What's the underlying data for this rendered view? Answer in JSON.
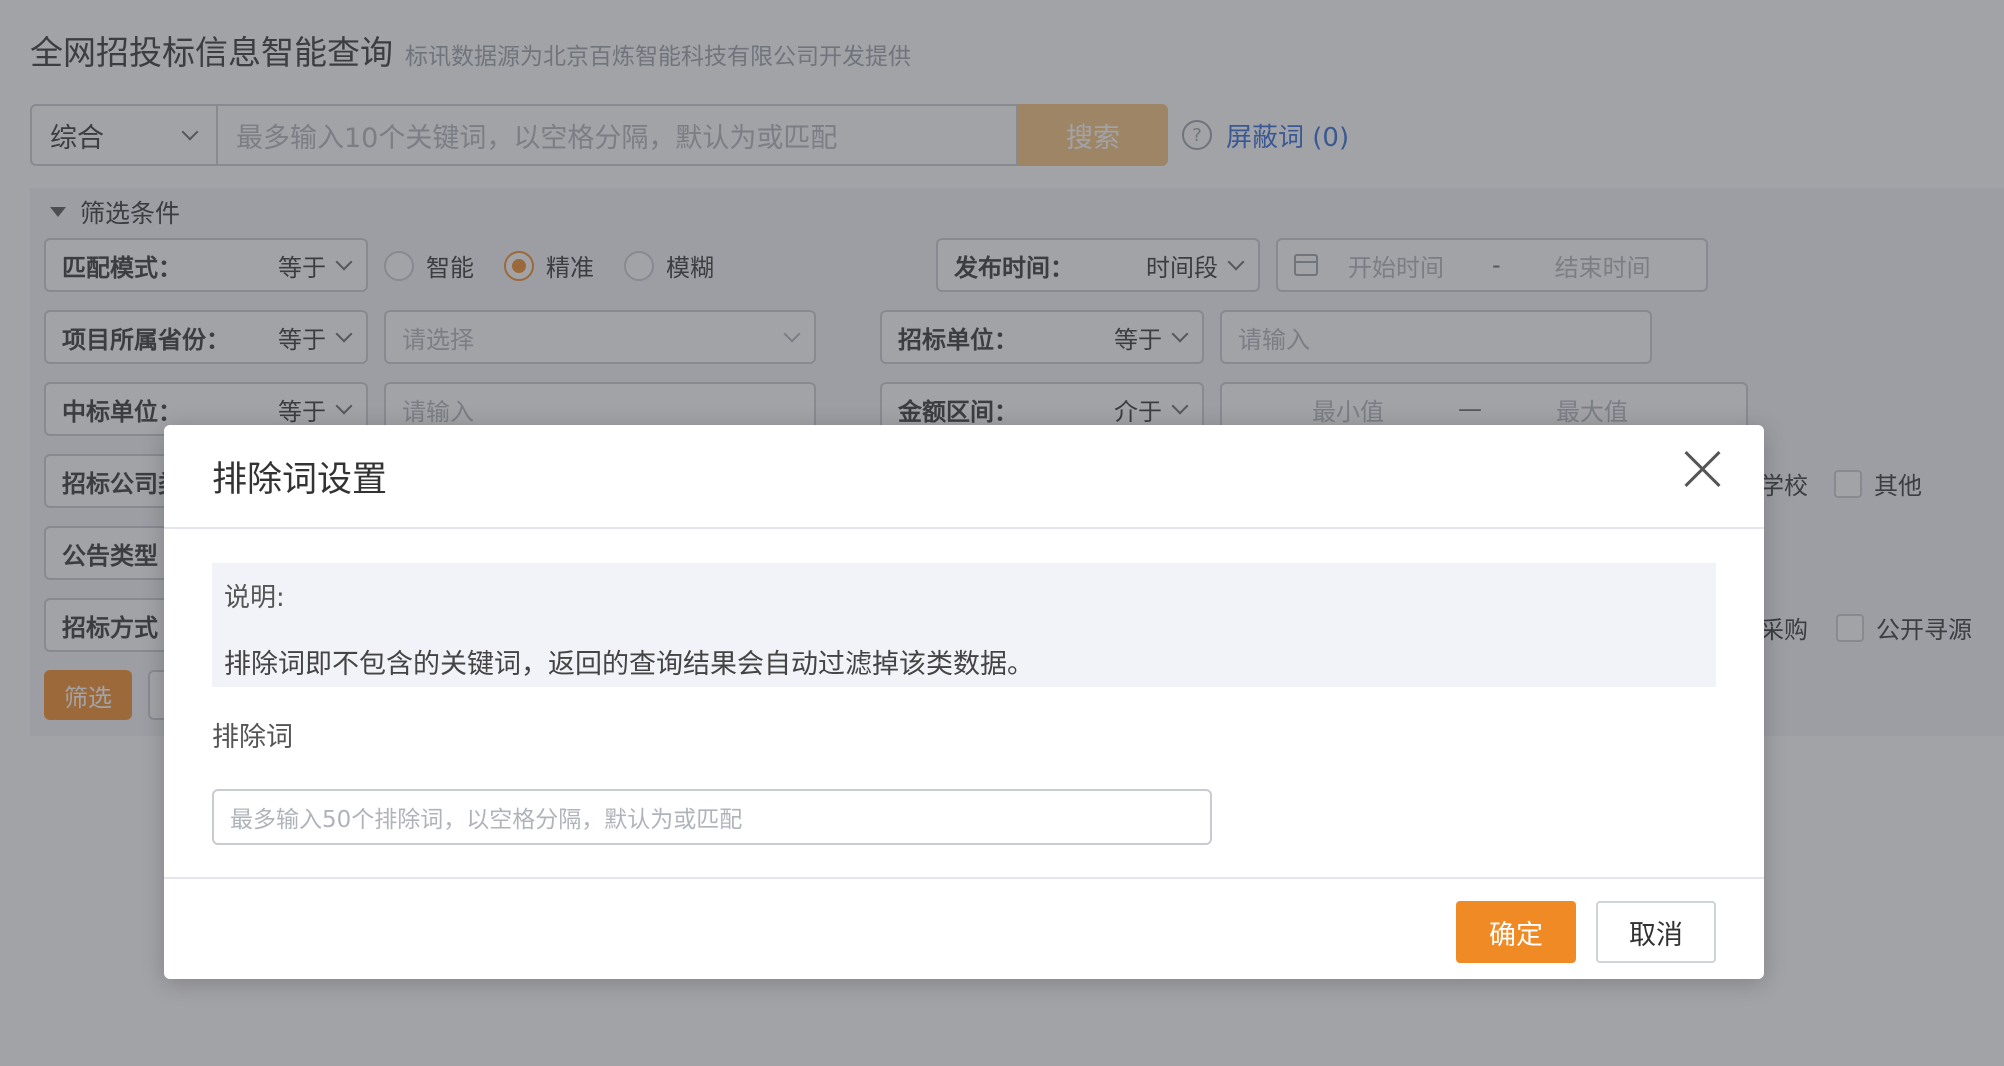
{
  "header": {
    "title": "全网招投标信息智能查询",
    "subtitle": "标讯数据源为北京百炼智能科技有限公司开发提供"
  },
  "search": {
    "type_value": "综合",
    "placeholder": "最多输入10个关键词，以空格分隔，默认为或匹配",
    "button_label": "搜索",
    "help_icon": "?",
    "blocked_words_label": "屏蔽词",
    "blocked_words_count": "(0)"
  },
  "filters": {
    "header_label": "筛选条件",
    "match_mode": {
      "label": "匹配模式：",
      "value": "等于"
    },
    "match_options": [
      {
        "label": "智能",
        "selected": false
      },
      {
        "label": "精准",
        "selected": true
      },
      {
        "label": "模糊",
        "selected": false
      }
    ],
    "publish_time": {
      "label": "发布时间：",
      "value": "时间段",
      "start_placeholder": "开始时间",
      "separator": "-",
      "end_placeholder": "结束时间"
    },
    "province": {
      "label": "项目所属省份：",
      "value": "等于",
      "placeholder": "请选择"
    },
    "tender_unit": {
      "label": "招标单位：",
      "value": "等于",
      "placeholder": "请输入"
    },
    "winning_unit": {
      "label": "中标单位：",
      "value": "等于",
      "placeholder": "请输入"
    },
    "amount_range": {
      "label": "金额区间：",
      "value": "介于",
      "min_placeholder": "最小值",
      "separator": "—",
      "max_placeholder": "最大值"
    },
    "company_type": {
      "label": "招标公司类"
    },
    "notice_type": {
      "label": "公告类型"
    },
    "tender_method": {
      "label": "招标方式"
    },
    "company_partial_option": "学校",
    "company_other_option": "其他",
    "method_partial_option": "采购",
    "method_public_option": "公开寻源",
    "filter_button": "筛选"
  },
  "modal": {
    "title": "排除词设置",
    "note_title": "说明:",
    "note_text": "排除词即不包含的关键词，返回的查询结果会自动过滤掉该类数据。",
    "field_label": "排除词",
    "field_placeholder": "最多输入50个排除词，以空格分隔，默认为或匹配",
    "ok_label": "确定",
    "cancel_label": "取消"
  },
  "colors": {
    "accent": "#f08a24",
    "link": "#2f6bd8",
    "search_button": "#f4c37a"
  }
}
